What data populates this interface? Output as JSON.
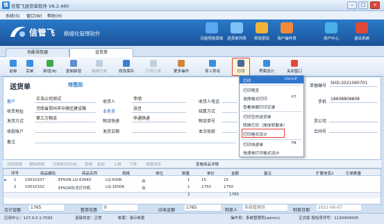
{
  "window": {
    "title": "信管飞送货单软件 V9.2.480",
    "minimize": "–",
    "maximize": "□",
    "close": "×"
  },
  "menu": [
    "系统(S)",
    "窗口(W)",
    "帮助(H)"
  ],
  "banner": {
    "logo_text": "信管飞",
    "slogan": "精细化管理软件",
    "buttons": [
      {
        "label": "功能导航菜单",
        "icon": "nav-menu-icon",
        "color": "#5aa9ef"
      },
      {
        "label": "送货单列表",
        "icon": "list-icon",
        "color": "#7fc1f7"
      },
      {
        "label": "修改密码",
        "icon": "key-icon",
        "color": "#f2b33d"
      },
      {
        "label": "用户操作员",
        "icon": "user-icon",
        "color": "#f28a3b"
      },
      {
        "label": "用户中心",
        "icon": "home-icon",
        "color": "#4ab0e8"
      },
      {
        "label": "退出系统",
        "icon": "power-icon",
        "color": "#e04a3a"
      }
    ]
  },
  "tabs": [
    {
      "label": "功能导航器",
      "active": false
    },
    {
      "label": "送货单",
      "active": true
    }
  ],
  "toolbar": [
    {
      "label": "前单",
      "icon": "prev-icon",
      "color": "#3a8ee0",
      "disabled": false
    },
    {
      "label": "后单",
      "icon": "next-icon",
      "color": "#3a8ee0",
      "disabled": false
    },
    {
      "label": "新增(N)",
      "icon": "add-icon",
      "color": "#3eaa4a",
      "disabled": false
    },
    {
      "label": "复制新增",
      "icon": "copy-icon",
      "color": "#5b8fd0",
      "disabled": false
    },
    {
      "label": "编辑开单",
      "icon": "edit-icon",
      "color": "#8aa3c2",
      "disabled": true
    },
    {
      "label": "修改保存",
      "icon": "save-icon",
      "color": "#3a7fd0",
      "disabled": false
    },
    {
      "label": "引用订单",
      "icon": "reference-icon",
      "color": "#8aa3c2",
      "disabled": true
    },
    {
      "label": "更多操作",
      "icon": "more-icon",
      "color": "#d0853a",
      "disabled": false
    },
    {
      "label": "导入导出",
      "icon": "import-export-icon",
      "color": "#3a8ee0",
      "disabled": false
    },
    {
      "label": "打印",
      "icon": "printer-icon",
      "color": "#4a6b9a",
      "disabled": false
    },
    {
      "label": "界面设计",
      "icon": "design-icon",
      "color": "#3a8ee0",
      "disabled": false
    },
    {
      "label": "关闭窗口",
      "icon": "close-window-icon",
      "color": "#e04a3a",
      "disabled": false
    }
  ],
  "form": {
    "doc_title": "送货单",
    "status": "待签回",
    "doc_no_label": "单据编号",
    "doc_no": "SHD-2021060701",
    "fields": {
      "customer_label": "客户",
      "customer": "正浩公司测试",
      "address_label": "收货地址",
      "address": "河南省郑州市中原区建设路",
      "ship_label": "发货方式",
      "ship": "第三方物流",
      "account_label": "收款账户",
      "account": "",
      "remark_label": "备注",
      "remark": "",
      "receiver_label": "收货人",
      "receiver": "李旭",
      "sales_label": "业务员",
      "sales": "张豆",
      "logistics_label": "物流快递",
      "logistics": "申通快递",
      "ship_date_label": "发货日期",
      "ship_date": "",
      "receiver_phone_label": "收货人电话",
      "settle_label": "结算方式",
      "logistics_no_label": "物流单号",
      "received_label": "本次收款",
      "phone_label": "手机",
      "phone": "18608808808",
      "vendor_label": "货公司",
      "box_label": "合同号"
    }
  },
  "print_menu": [
    {
      "label": "打印",
      "shortcut": "Ctrl+P"
    },
    {
      "label": "打印预览",
      "shortcut": ""
    },
    {
      "label": "选择格式打印",
      "shortcut": "F7"
    },
    {
      "label": "查看单据打印记录",
      "shortcut": ""
    },
    {
      "label": "打印空白送货单",
      "shortcut": ""
    },
    {
      "label": "转换打印（简体转繁体）",
      "shortcut": ""
    },
    {
      "label": "打印格式设计",
      "shortcut": ""
    },
    {
      "label": "打印快递单",
      "shortcut": "F8"
    },
    {
      "label": "快递单打印格式设计",
      "shortcut": ""
    }
  ],
  "grid_toolbar": [
    {
      "label": "添加明细",
      "active": false
    },
    {
      "label": "删除明细",
      "active": false
    },
    {
      "label": "扫描条形码(B)",
      "active": false
    },
    {
      "label": "复制",
      "active": false
    },
    {
      "label": "粘贴",
      "active": false
    },
    {
      "label": "上移",
      "active": false
    },
    {
      "label": "下移",
      "active": false
    },
    {
      "label": "快速排序",
      "active": false
    },
    {
      "label": "查看商品详情",
      "active": true
    }
  ],
  "grid": {
    "headers": [
      "序号",
      "商品编码",
      "商品名称",
      "规格",
      "单位",
      "数量",
      "单价",
      "金额",
      "备注",
      "扩展信息2",
      "引单数量"
    ],
    "rows": [
      [
        "1",
        "10010107",
        "EPSON LQ-630KII",
        "LQ-630K",
        "台",
        "1",
        "15",
        "15",
        "",
        "",
        ""
      ],
      [
        "2",
        "10010102",
        "EPSON针式打印机",
        "LQ-1600K",
        "台",
        "1",
        "1750",
        "1750",
        "",
        "",
        ""
      ]
    ],
    "total_qty": "2",
    "total_amount": "1765"
  },
  "footer": {
    "total_label": "合计金额",
    "total": "1765",
    "discount_label": "整单优惠",
    "discount": "0",
    "receivable_label": "应收金额",
    "receivable": "1765",
    "maker_label": "制单人",
    "maker": "系统管理员",
    "date_label": "制单日期",
    "date": "2021-06-07"
  },
  "statusbar": {
    "center": "应用中心：127.0.0.1:7093",
    "connection": "连接状态：正常",
    "account_set": "帐套：演示帐套",
    "operator": "操作员：系统管理员(admin)",
    "version": "正式版  授权序列号：1130904505"
  }
}
